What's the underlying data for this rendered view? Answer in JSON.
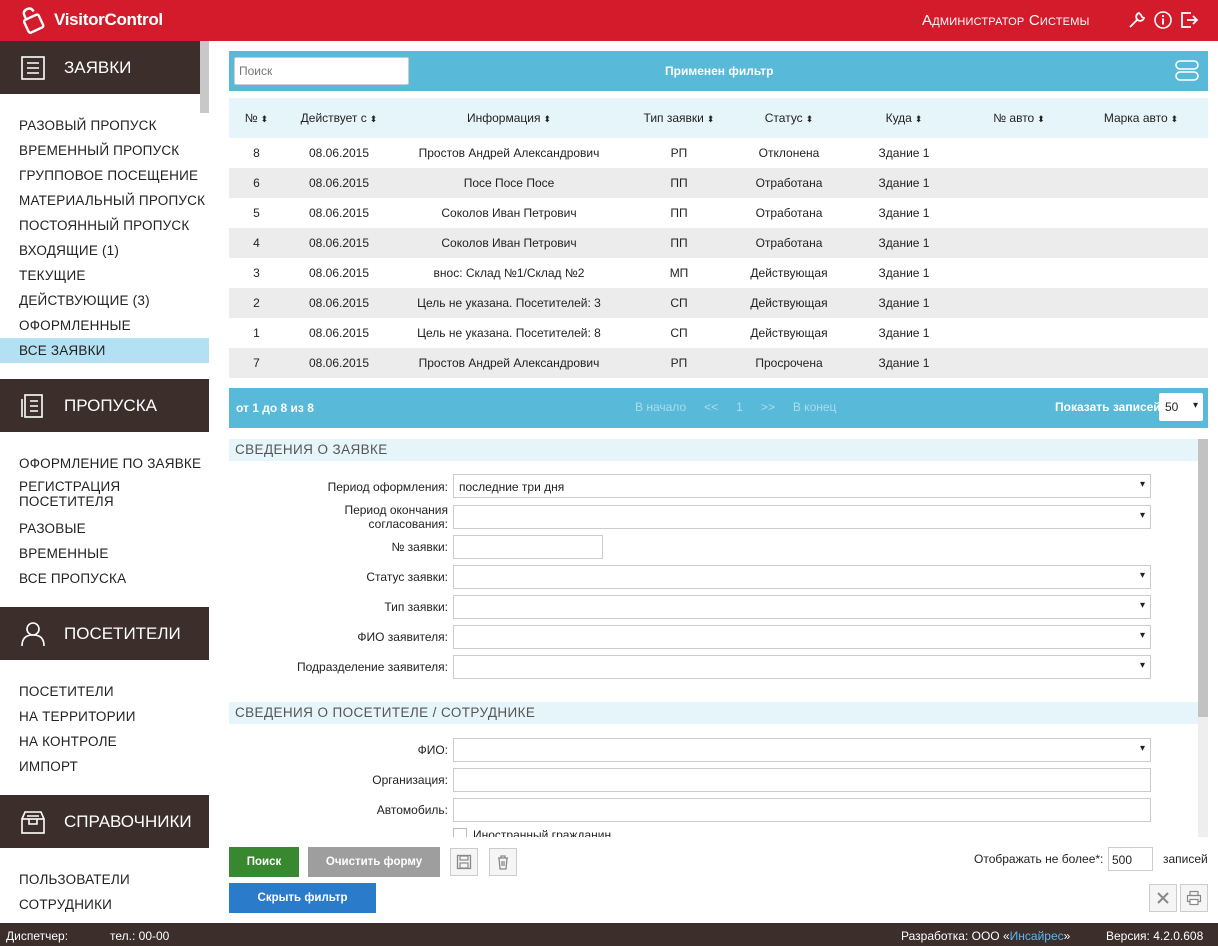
{
  "app": {
    "name": "VisitorControl",
    "user": "Администратор Системы"
  },
  "sidebar": {
    "requests": {
      "title": "ЗАЯВКИ",
      "items": [
        "РАЗОВЫЙ ПРОПУСК",
        "ВРЕМЕННЫЙ ПРОПУСК",
        "ГРУППОВОЕ ПОСЕЩЕНИЕ",
        "МАТЕРИАЛЬНЫЙ ПРОПУСК",
        "ПОСТОЯННЫЙ ПРОПУСК",
        "ВХОДЯЩИЕ (1)",
        "ТЕКУЩИЕ",
        "ДЕЙСТВУЮЩИЕ (3)",
        "ОФОРМЛЕННЫЕ",
        "ВСЕ ЗАЯВКИ"
      ],
      "active_index": 9
    },
    "passes": {
      "title": "ПРОПУСКА",
      "items": [
        "ОФОРМЛЕНИЕ ПО ЗАЯВКЕ",
        "РЕГИСТРАЦИЯ ПОСЕТИТЕЛЯ",
        "РАЗОВЫЕ",
        "ВРЕМЕННЫЕ",
        "ВСЕ ПРОПУСКА"
      ]
    },
    "visitors": {
      "title": "ПОСЕТИТЕЛИ",
      "items": [
        "ПОСЕТИТЕЛИ",
        "НА ТЕРРИТОРИИ",
        "НА КОНТРОЛЕ",
        "ИМПОРТ"
      ]
    },
    "refs": {
      "title": "СПРАВОЧНИКИ",
      "items": [
        "ПОЛЬЗОВАТЕЛИ",
        "СОТРУДНИКИ"
      ]
    }
  },
  "filter": {
    "search_placeholder": "Поиск",
    "applied": "Применен фильтр"
  },
  "table": {
    "headers": [
      "№",
      "Действует с",
      "Информация",
      "Тип заявки",
      "Статус",
      "Куда",
      "№ авто",
      "Марка авто"
    ],
    "rows": [
      [
        "8",
        "08.06.2015",
        "Простов Андрей Александрович",
        "РП",
        "Отклонена",
        "Здание 1",
        "",
        ""
      ],
      [
        "6",
        "08.06.2015",
        "Посе Посе Посе",
        "ПП",
        "Отработана",
        "Здание 1",
        "",
        ""
      ],
      [
        "5",
        "08.06.2015",
        "Соколов Иван Петрович",
        "ПП",
        "Отработана",
        "Здание 1",
        "",
        ""
      ],
      [
        "4",
        "08.06.2015",
        "Соколов Иван Петрович",
        "ПП",
        "Отработана",
        "Здание 1",
        "",
        ""
      ],
      [
        "3",
        "08.06.2015",
        "внос: Склад №1/Склад №2",
        "МП",
        "Действующая",
        "Здание 1",
        "",
        ""
      ],
      [
        "2",
        "08.06.2015",
        "Цель не указана. Посетителей: 3",
        "СП",
        "Действующая",
        "Здание 1",
        "",
        ""
      ],
      [
        "1",
        "08.06.2015",
        "Цель не указана. Посетителей: 8",
        "СП",
        "Действующая",
        "Здание 1",
        "",
        ""
      ],
      [
        "7",
        "08.06.2015",
        "Простов Андрей Александрович",
        "РП",
        "Просрочена",
        "Здание 1",
        "",
        ""
      ]
    ]
  },
  "pager": {
    "count": "от 1 до 8 из 8",
    "first": "В начало",
    "prev": "<<",
    "page": "1",
    "next": ">>",
    "last": "В конец",
    "show_label": "Показать записей",
    "show_value": "50"
  },
  "form": {
    "section1": "СВЕДЕНИЯ О ЗАЯВКЕ",
    "period_label": "Период оформления:",
    "period_value": "последние три дня",
    "approval_label": "Период окончания согласования:",
    "number_label": "№ заявки:",
    "status_label": "Статус заявки:",
    "type_label": "Тип заявки:",
    "applicant_label": "ФИО заявителя:",
    "dept_label": "Подразделение заявителя:",
    "section2": "СВЕДЕНИЯ О ПОСЕТИТЕЛЕ / СОТРУДНИКЕ",
    "fio_label": "ФИО:",
    "org_label": "Организация:",
    "car_label": "Автомобиль:",
    "foreign_label": "Иностранный гражданин"
  },
  "buttons": {
    "search": "Поиск",
    "clear": "Очистить форму",
    "hide": "Скрыть фильтр",
    "limit_label": "Отображать не более*:",
    "limit_value": "500",
    "limit_unit": "записей"
  },
  "footer": {
    "dispatcher": "Диспетчер:",
    "phone": "тел.: 00-00",
    "dev_prefix": "Разработка: ООО «",
    "dev_link": "Инсайрес",
    "dev_suffix": "»",
    "version": "Версия: 4.2.0.608"
  },
  "colors": {
    "brand_red": "#d41b2c",
    "sidebar_dark": "#3b2e2b",
    "accent_blue": "#58b9d8",
    "search_green": "#37882f",
    "clear_gray": "#9e9e9e",
    "hide_blue": "#2b7bcb",
    "link_blue": "#5bb8f0"
  }
}
